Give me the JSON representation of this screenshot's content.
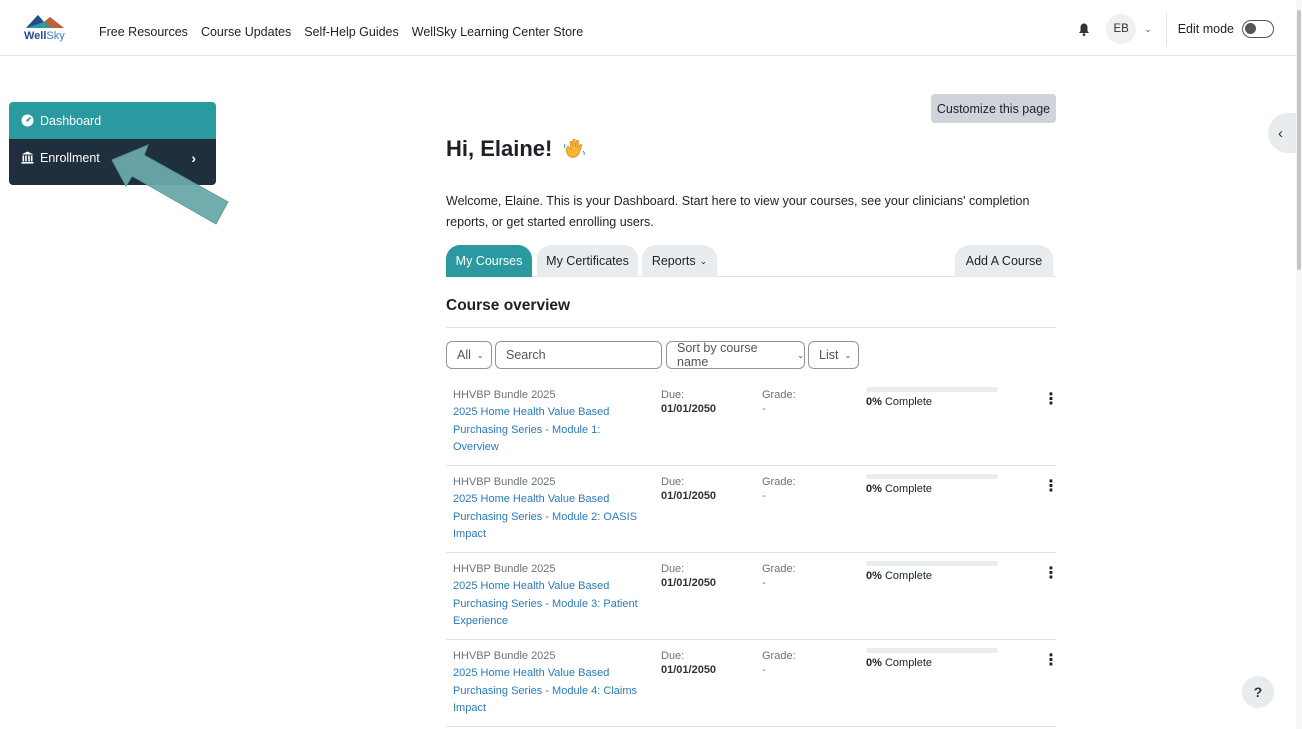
{
  "topbar": {
    "logo_text_bold": "Well",
    "logo_text_light": "Sky",
    "nav": [
      "Free Resources",
      "Course Updates",
      "Self-Help Guides",
      "WellSky Learning Center Store"
    ],
    "avatar_initials": "EB",
    "edit_mode_label": "Edit mode",
    "edit_mode_on": false
  },
  "sidebar": {
    "items": [
      {
        "label": "Dashboard",
        "icon": "dashboard-icon",
        "active": true
      },
      {
        "label": "Enrollment",
        "icon": "bank-icon",
        "active": false
      }
    ]
  },
  "main": {
    "customize_label": "Customize this page",
    "greeting": "Hi, Elaine!",
    "welcome_text": "Welcome, Elaine. This is your Dashboard. Start here to view your courses, see your clinicians' completion reports, or get started enrolling users.",
    "tabs": [
      {
        "label": "My Courses",
        "active": true
      },
      {
        "label": "My Certificates",
        "active": false
      },
      {
        "label": "Reports",
        "active": false
      },
      {
        "label": "Add A Course",
        "active": false
      }
    ],
    "overview_title": "Course overview",
    "filters": {
      "all_label": "All",
      "search_placeholder": "Search",
      "sort_label": "Sort by course name",
      "view_label": "List"
    },
    "courses": [
      {
        "bundle": "HHVBP Bundle 2025",
        "name": "2025 Home Health Value Based Purchasing Series - Module 1: Overview",
        "due_label": "Due:",
        "due": "01/01/2050",
        "grade_label": "Grade:",
        "grade": "-",
        "progress_pct": "0%",
        "progress_label": "Complete",
        "progress_value": 0
      },
      {
        "bundle": "HHVBP Bundle 2025",
        "name": "2025 Home Health Value Based Purchasing Series - Module 2: OASIS Impact",
        "due_label": "Due:",
        "due": "01/01/2050",
        "grade_label": "Grade:",
        "grade": "-",
        "progress_pct": "0%",
        "progress_label": "Complete",
        "progress_value": 0
      },
      {
        "bundle": "HHVBP Bundle 2025",
        "name": "2025 Home Health Value Based Purchasing Series - Module 3: Patient Experience",
        "due_label": "Due:",
        "due": "01/01/2050",
        "grade_label": "Grade:",
        "grade": "-",
        "progress_pct": "0%",
        "progress_label": "Complete",
        "progress_value": 0
      },
      {
        "bundle": "HHVBP Bundle 2025",
        "name": "2025 Home Health Value Based Purchasing Series - Module 4: Claims Impact",
        "due_label": "Due:",
        "due": "01/01/2050",
        "grade_label": "Grade:",
        "grade": "-",
        "progress_pct": "0%",
        "progress_label": "Complete",
        "progress_value": 0
      }
    ]
  },
  "help_label": "?",
  "colors": {
    "accent": "#2b9aa0",
    "sidebar_dark": "#1f2f3d",
    "link": "#2a7ab8"
  }
}
